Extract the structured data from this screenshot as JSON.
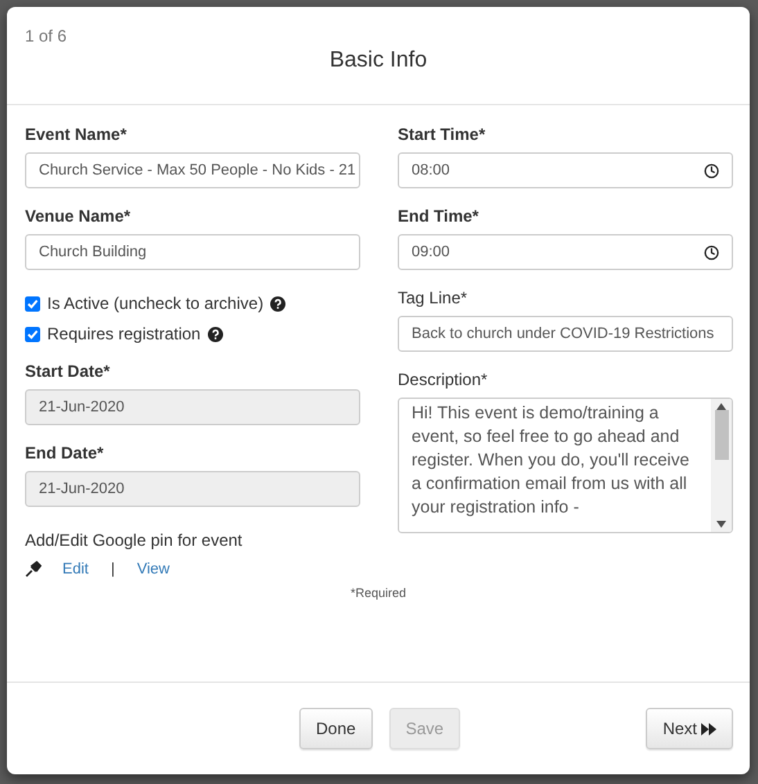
{
  "modal": {
    "step": "1 of 6",
    "title": "Basic Info"
  },
  "left": {
    "event_name": {
      "label": "Event Name*",
      "value": "Church Service - Max 50 People - No Kids - 21"
    },
    "venue_name": {
      "label": "Venue Name*",
      "value": "Church Building"
    },
    "checkboxes": [
      {
        "label": "Is Active (uncheck to archive)",
        "checked": true
      },
      {
        "label": "Requires registration",
        "checked": true
      }
    ],
    "start_date": {
      "label": "Start Date*",
      "value": "21-Jun-2020",
      "disabled": true
    },
    "end_date": {
      "label": "End Date*",
      "value": "21-Jun-2020",
      "disabled": true
    },
    "pin": {
      "label": "Add/Edit Google pin for event",
      "edit": "Edit",
      "separator": "|",
      "view": "View"
    }
  },
  "right": {
    "start_time": {
      "label": "Start Time*",
      "value": "08:00"
    },
    "end_time": {
      "label": "End Time*",
      "value": "09:00"
    },
    "tag_line": {
      "label": "Tag Line*",
      "value": "Back to church under COVID-19 Restrictions"
    },
    "description": {
      "label": "Description*",
      "value": "Hi! This event is demo/training a event, so feel free to go ahead and register. When you do, you'll receive a confirmation email from us with all your registration info -"
    }
  },
  "required_note": "*Required",
  "footer": {
    "buttons": [
      {
        "label": "Done",
        "disabled": false
      },
      {
        "label": "Save",
        "disabled": true
      }
    ],
    "next": "Next"
  }
}
